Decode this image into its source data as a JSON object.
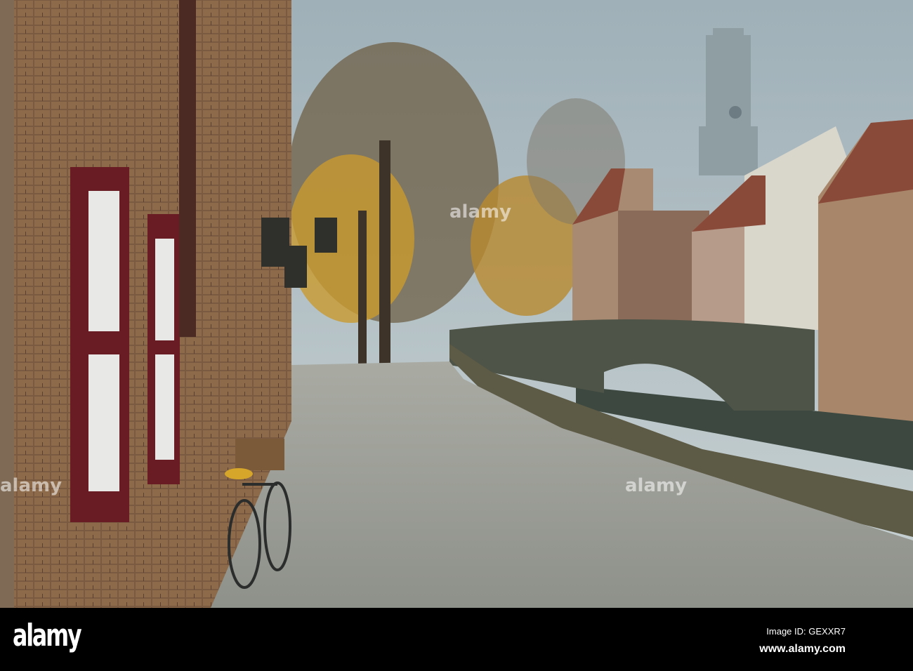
{
  "photo": {
    "description_label": "Cobbled canal-side street with brick houses, bicycle, stone bridge and belfry tower",
    "watermark": "alamy"
  },
  "footer": {
    "logo": "alamy",
    "image_id": "Image ID: GEXXR7",
    "url": "www.alamy.com"
  }
}
